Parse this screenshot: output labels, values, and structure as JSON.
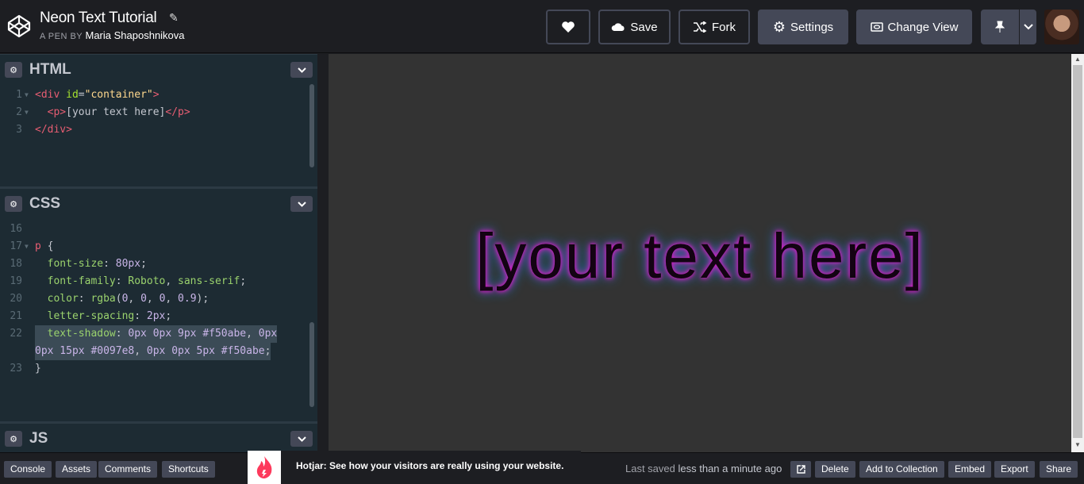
{
  "header": {
    "title": "Neon Text Tutorial",
    "byline_prefix": "A PEN BY",
    "author": "Maria Shaposhnikova",
    "buttons": {
      "save": "Save",
      "fork": "Fork",
      "settings": "Settings",
      "change_view": "Change View"
    }
  },
  "panes": {
    "html": {
      "label": "HTML",
      "lines": [
        {
          "n": "1",
          "parts": [
            [
              "tag",
              "<div "
            ],
            [
              "attr",
              "id"
            ],
            [
              "txt",
              "="
            ],
            [
              "str",
              "\"container\""
            ],
            [
              "tag",
              ">"
            ]
          ]
        },
        {
          "n": "2",
          "parts": [
            [
              "txt",
              "  "
            ],
            [
              "tag",
              "<p>"
            ],
            [
              "txt",
              "[your text here]"
            ],
            [
              "tag",
              "</p>"
            ]
          ]
        },
        {
          "n": "3",
          "parts": [
            [
              "tag",
              "</div>"
            ]
          ]
        }
      ]
    },
    "css": {
      "label": "CSS",
      "lines": [
        {
          "n": "16",
          "parts": []
        },
        {
          "n": "17",
          "parts": [
            [
              "tag",
              "p"
            ],
            [
              "txt",
              " {"
            ]
          ]
        },
        {
          "n": "18",
          "parts": [
            [
              "txt",
              "  "
            ],
            [
              "prop",
              "font-size"
            ],
            [
              "txt",
              ": "
            ],
            [
              "val",
              "80px"
            ],
            [
              "txt",
              ";"
            ]
          ]
        },
        {
          "n": "19",
          "parts": [
            [
              "txt",
              "  "
            ],
            [
              "prop",
              "font-family"
            ],
            [
              "txt",
              ": "
            ],
            [
              "prop",
              "Roboto"
            ],
            [
              "txt",
              ", "
            ],
            [
              "prop",
              "sans-serif"
            ],
            [
              "txt",
              ";"
            ]
          ]
        },
        {
          "n": "20",
          "parts": [
            [
              "txt",
              "  "
            ],
            [
              "prop",
              "color"
            ],
            [
              "txt",
              ": "
            ],
            [
              "prop",
              "rgba"
            ],
            [
              "txt",
              "("
            ],
            [
              "val",
              "0"
            ],
            [
              "txt",
              ", "
            ],
            [
              "val",
              "0"
            ],
            [
              "txt",
              ", "
            ],
            [
              "val",
              "0"
            ],
            [
              "txt",
              ", "
            ],
            [
              "val",
              "0.9"
            ],
            [
              "txt",
              ");"
            ]
          ]
        },
        {
          "n": "21",
          "parts": [
            [
              "txt",
              "  "
            ],
            [
              "prop",
              "letter-spacing"
            ],
            [
              "txt",
              ": "
            ],
            [
              "val",
              "2px"
            ],
            [
              "txt",
              ";"
            ]
          ]
        },
        {
          "n": "22",
          "parts": [
            [
              "txt",
              "  "
            ],
            [
              "prop",
              "text-shadow"
            ],
            [
              "txt",
              ": "
            ],
            [
              "val",
              "0px 0px 9px #f50abe"
            ],
            [
              "txt",
              ", "
            ],
            [
              "val",
              "0px"
            ]
          ]
        },
        {
          "n": "",
          "parts": [
            [
              "val",
              "0px 15px #0097e8"
            ],
            [
              "txt",
              ", "
            ],
            [
              "val",
              "0px 0px 5px #f50abe"
            ],
            [
              "txt",
              ";"
            ]
          ]
        },
        {
          "n": "23",
          "parts": [
            [
              "txt",
              "}"
            ]
          ]
        }
      ]
    },
    "js": {
      "label": "JS"
    }
  },
  "preview": {
    "text": "[your text here]"
  },
  "footer": {
    "console": "Console",
    "assets": "Assets",
    "comments": "Comments",
    "shortcuts": "Shortcuts",
    "ad_text": "Hotjar: See how your visitors are really using your website.",
    "saved_prefix": "Last saved",
    "saved_time": "less than a minute ago",
    "delete": "Delete",
    "add_to_collection": "Add to Collection",
    "embed": "Embed",
    "export": "Export",
    "share": "Share"
  },
  "colors": {
    "accent": "#f50abe",
    "secondary": "#0097e8"
  },
  "icons": [
    "codepen-logo-icon",
    "pencil-icon",
    "heart-icon",
    "cloud-icon",
    "fork-icon",
    "gear-icon",
    "change-view-icon",
    "pin-icon",
    "chevron-down-icon",
    "external-link-icon",
    "hotjar-icon"
  ]
}
